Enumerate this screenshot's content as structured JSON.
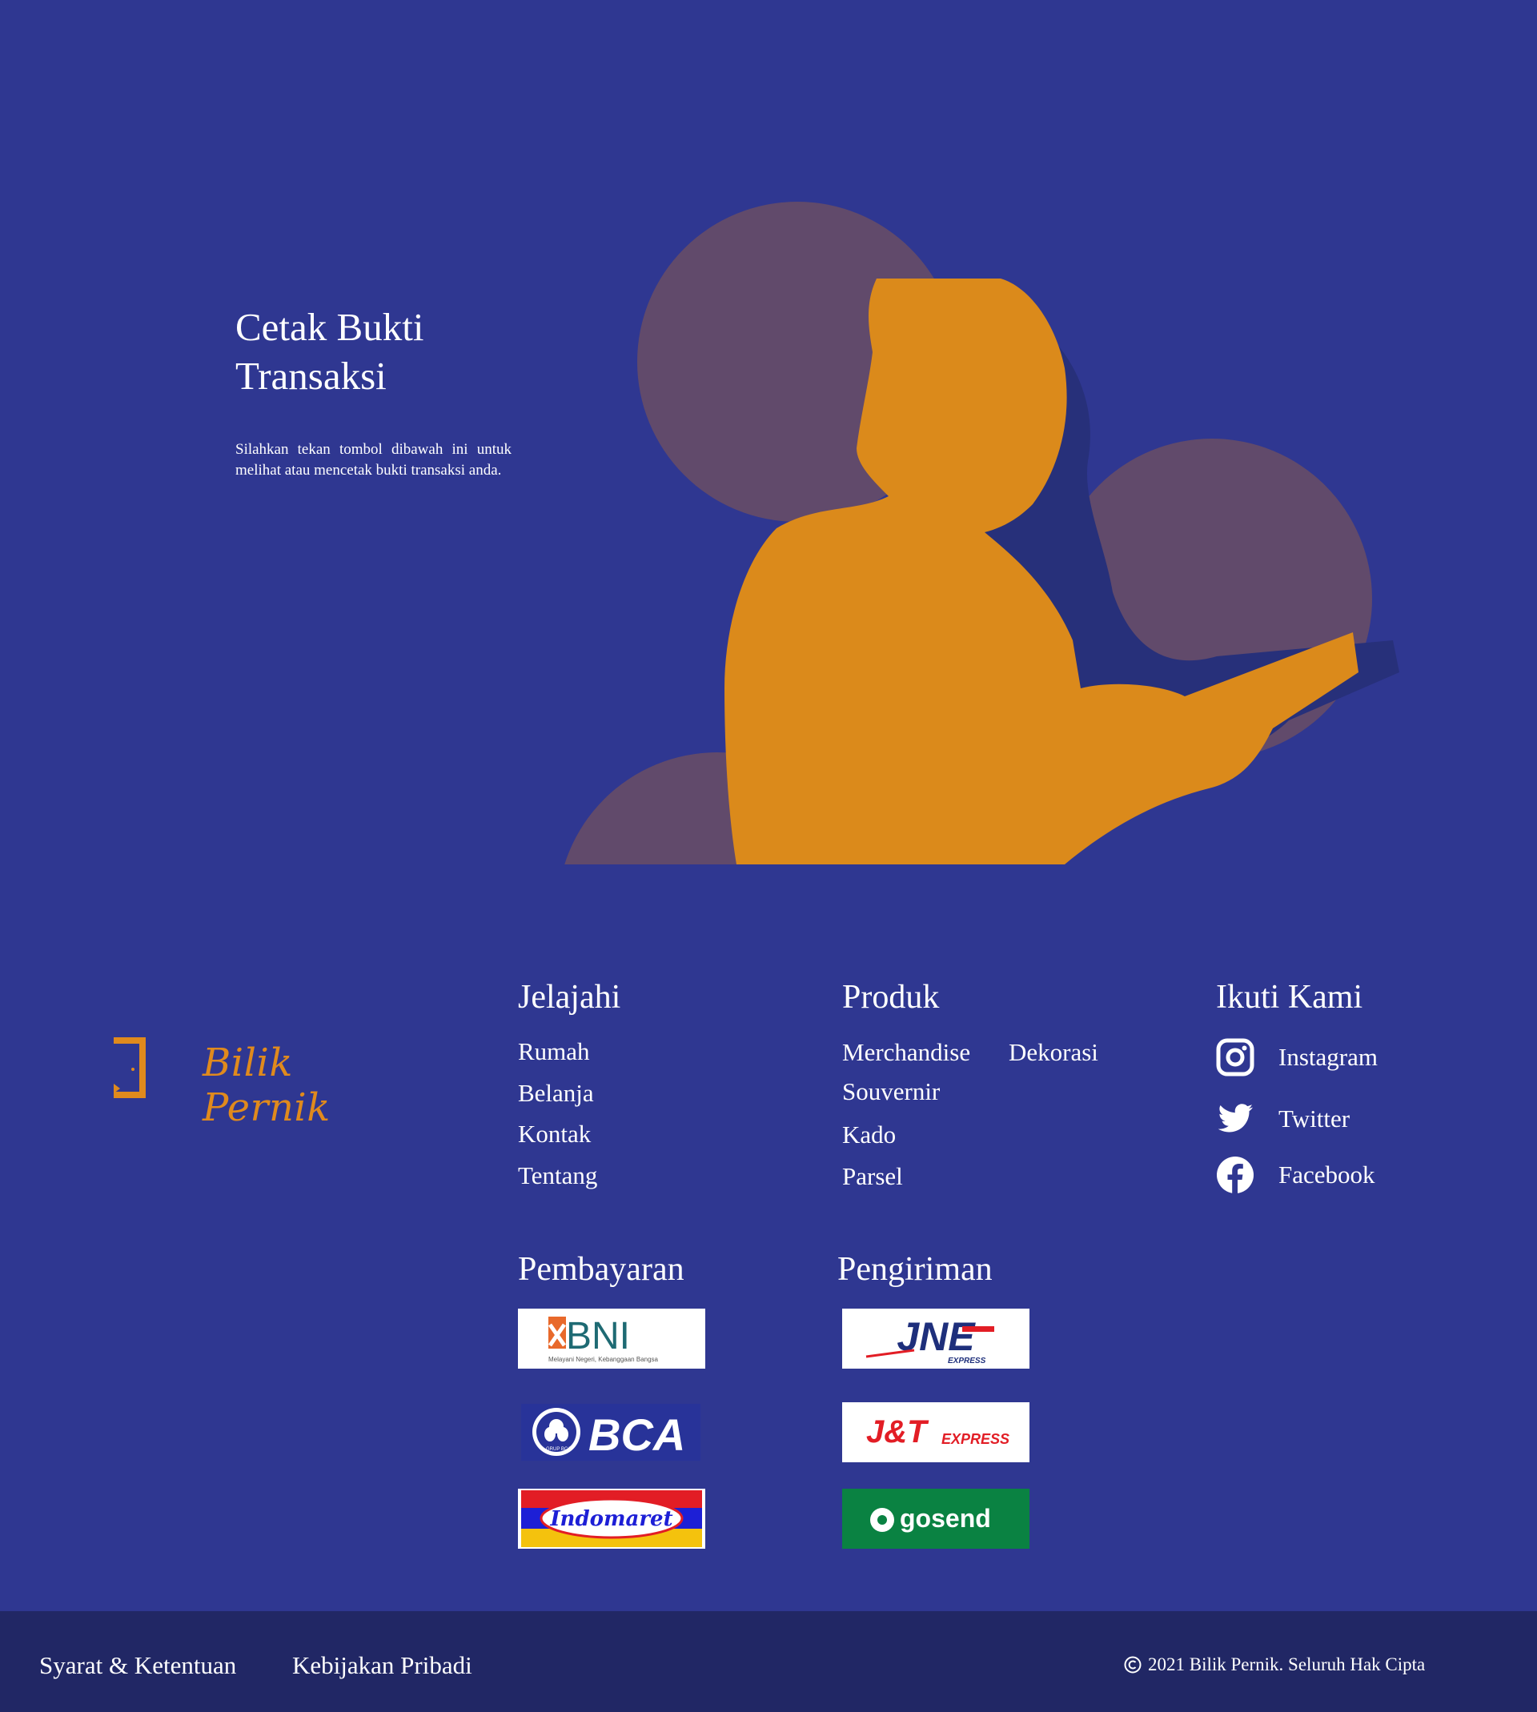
{
  "hero": {
    "title": "Cetak Bukti Transaksi",
    "description": "Silahkan tekan tombol dibawah ini untuk melihat atau mencetak bukti transaksi anda."
  },
  "brand": {
    "name": "Bilik Pernik"
  },
  "footer": {
    "explore": {
      "heading": "Jelajahi",
      "links": [
        "Rumah",
        "Belanja",
        "Kontak",
        "Tentang"
      ]
    },
    "products": {
      "heading": "Produk",
      "links": [
        "Merchandise",
        "Dekorasi",
        "Souvernir",
        "Kado",
        "Parsel"
      ]
    },
    "follow": {
      "heading": "Ikuti Kami",
      "items": [
        {
          "label": "Instagram",
          "icon": "instagram-icon"
        },
        {
          "label": "Twitter",
          "icon": "twitter-icon"
        },
        {
          "label": "Facebook",
          "icon": "facebook-icon"
        }
      ]
    },
    "payment": {
      "heading": "Pembayaran",
      "logos": [
        {
          "name": "BNI",
          "tagline": "Melayani Negeri, Kebanggaan Bangsa"
        },
        {
          "name": "BCA",
          "badge": "GRUP BCA"
        },
        {
          "name": "Indomaret"
        }
      ]
    },
    "shipping": {
      "heading": "Pengiriman",
      "logos": [
        {
          "name": "JNE",
          "tagline": "EXPRESS"
        },
        {
          "name": "J&T",
          "tagline": "EXPRESS"
        },
        {
          "name": "gosend"
        }
      ]
    }
  },
  "bottom_bar": {
    "terms": "Syarat & Ketentuan",
    "privacy": "Kebijakan Pribadi",
    "copyright": "2021 Bilik Pernik. Seluruh Hak Cipta"
  },
  "colors": {
    "background": "#2f3791",
    "bottom_bar": "#212765",
    "accent_orange": "#e08a1d",
    "circle_mauve": "#614a6b"
  }
}
